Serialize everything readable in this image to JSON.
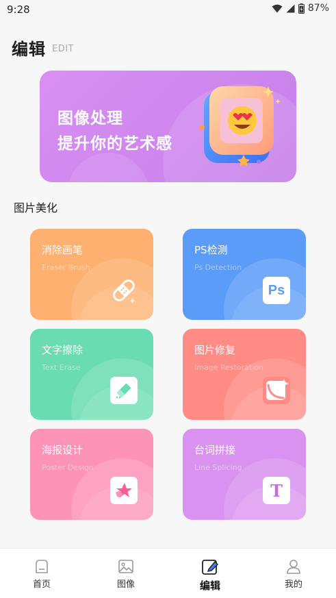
{
  "status_bar": {
    "time": "9:28",
    "battery": "87%"
  },
  "header": {
    "title": "编辑",
    "subtitle": "EDIT"
  },
  "banner": {
    "line1": "图像处理",
    "line2": "提升你的艺术感"
  },
  "section": {
    "title": "图片美化"
  },
  "tools": [
    {
      "title": "消除画笔",
      "subtitle": "Eraser Brush",
      "color": "#fdb06f",
      "icon": "bandage-icon"
    },
    {
      "title": "PS检测",
      "subtitle": "Ps Detection",
      "color": "#5b9cf8",
      "icon": "ps-icon",
      "icon_text": "Ps"
    },
    {
      "title": "文字擦除",
      "subtitle": "Text Erase",
      "color": "#69dcb1",
      "icon": "eraser-icon"
    },
    {
      "title": "图片修复",
      "subtitle": "Image Restoration",
      "color": "#fe8b84",
      "icon": "sparkle-image-icon"
    },
    {
      "title": "海报设计",
      "subtitle": "Poster Design",
      "color": "#fd93b7",
      "icon": "star-shape-icon"
    },
    {
      "title": "台词拼接",
      "subtitle": "Line Splicing",
      "color": "#d992ef",
      "icon": "text-t-icon",
      "icon_text": "T"
    }
  ],
  "nav": {
    "home": "首页",
    "images": "图像",
    "edit": "编辑",
    "mine": "我的"
  }
}
